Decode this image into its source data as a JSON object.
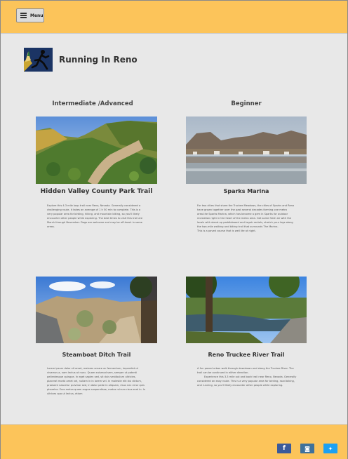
{
  "header": {
    "menu_label": "Menu"
  },
  "site": {
    "title": "Running In Reno"
  },
  "sections": {
    "left_label": "Intermediate /Advanced",
    "right_label": "Beginner"
  },
  "cards": [
    {
      "title": "Hidden Valley County Park Trail",
      "description": "Explore this 4.3 mile loop trail near Reno, Nevada. Generally considered a challenging route, it takes an average of 1 h 50 min to complete. This is a very popular area for birding, hiking, and mountain biking, so you'll likely encounter other people while exploring. The best times to visit this trail are March through November. Dogs are welcome and may be off-leash in some areas."
    },
    {
      "title": "Sparks Marina",
      "description": "For two cities that share the Truckee Meadows, the cities of Sparks and Reno have grown together over the past several decades forming one metro area.the Sparks Marina, which has become a gem in Sparks for outdoor recreation right in the heart of the metro area. Get some fresh air with the locals with stand-up paddleboard and kayak rentals, stretch your legs along the two-mile walking and biking trail that surrounds The Marina.",
      "note": "This is a paved course that is well lite at night."
    },
    {
      "title": "Steamboat Ditch Trail",
      "description": "Lorem ipsum dolor sit amet, maiores ornare ac fermentum, imperdiet ut vivamus a, nam lectus at nunc. Quam euismod sem, semper ut potenti pellentesque quisque. In eget sapien sed, sit duis vestibulum ultricies, placerat morbi amet vel, nullam in in lorem vel. In molestie elit dui dictum, praesent nascetur pulvinar sed, in dolor pede in aliquam, risus nec error quis pharetra. Eros metus quam augue suspendisse, metus rutrum risus erat in. In ultrices quo ut lectus, etiam"
    },
    {
      "title": "Reno Truckee River Trail",
      "description": "A fun paved urban walk through downtown and along the Truckee River. The trail can be continued in either direction.",
      "note": "Experience this 3.3 mile out and back trail near Reno, Nevada. Generally considered an easy route. This is a very popular area for birding, road biking, and running, so you'll likely encounter other people while exploring."
    }
  ],
  "footer": {
    "social": [
      {
        "icon": "facebook-icon",
        "color": "#3b5a9a",
        "glyph": "f"
      },
      {
        "icon": "instagram-icon",
        "color": "#3f729b",
        "glyph": "◙"
      },
      {
        "icon": "twitter-icon",
        "color": "#1da1f2",
        "glyph": "✦"
      }
    ]
  },
  "colors": {
    "accent": "#fcc45a",
    "page": "#e8e8e8"
  }
}
